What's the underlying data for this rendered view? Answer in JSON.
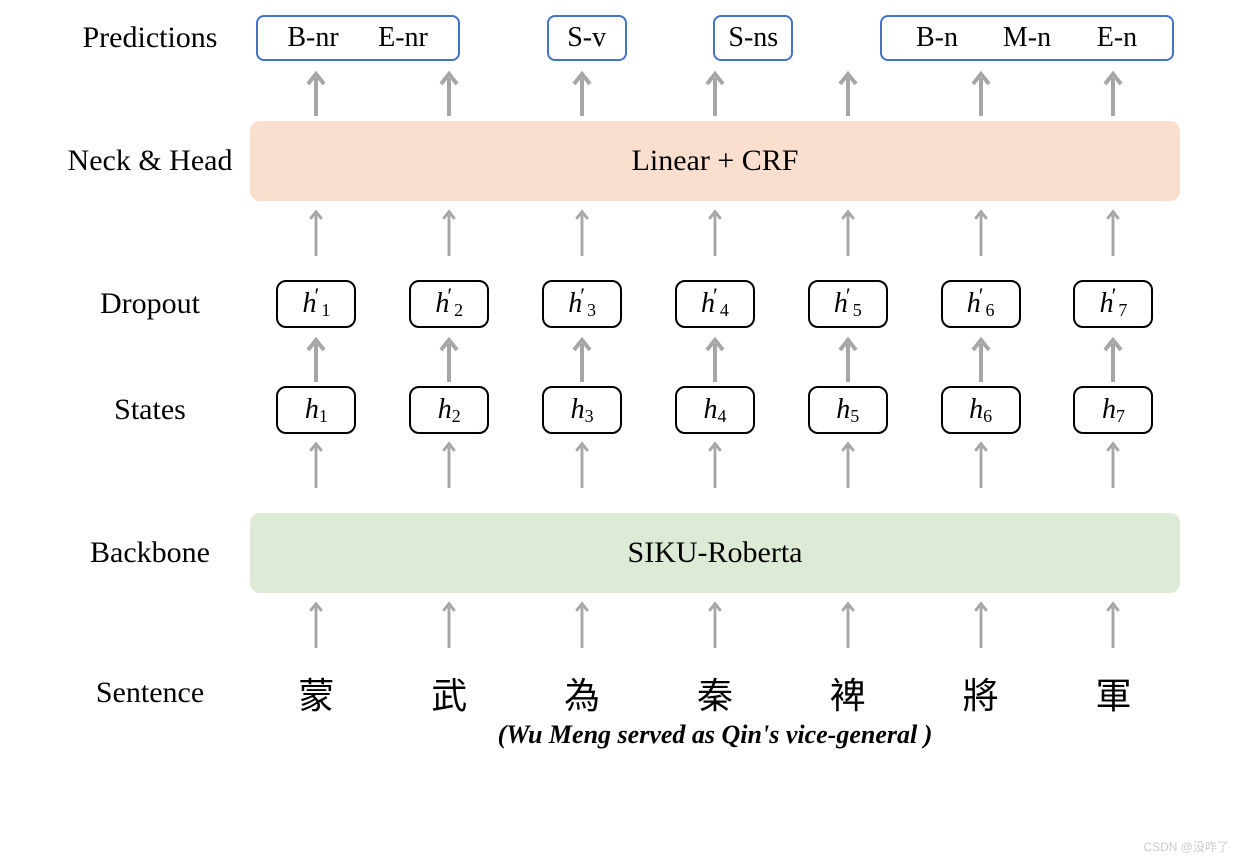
{
  "labels": {
    "predictions": "Predictions",
    "neckhead": "Neck & Head",
    "dropout": "Dropout",
    "states": "States",
    "backbone": "Backbone",
    "sentence": "Sentence"
  },
  "blocks": {
    "neckhead": "Linear + CRF",
    "backbone": "SIKU-Roberta"
  },
  "predictions": {
    "group1": [
      "B-nr",
      "E-nr"
    ],
    "solo1": "S-v",
    "solo2": "S-ns",
    "group2": [
      "B-n",
      "M-n",
      "E-n"
    ]
  },
  "dropout": [
    "h′1",
    "h′2",
    "h′3",
    "h′4",
    "h′5",
    "h′6",
    "h′7"
  ],
  "states": [
    "h1",
    "h2",
    "h3",
    "h4",
    "h5",
    "h6",
    "h7"
  ],
  "sentence": [
    "蒙",
    "武",
    "為",
    "秦",
    "裨",
    "將",
    "軍"
  ],
  "translation": "(Wu Meng served as Qin's vice-general )",
  "watermark": "CSDN @没咋了"
}
